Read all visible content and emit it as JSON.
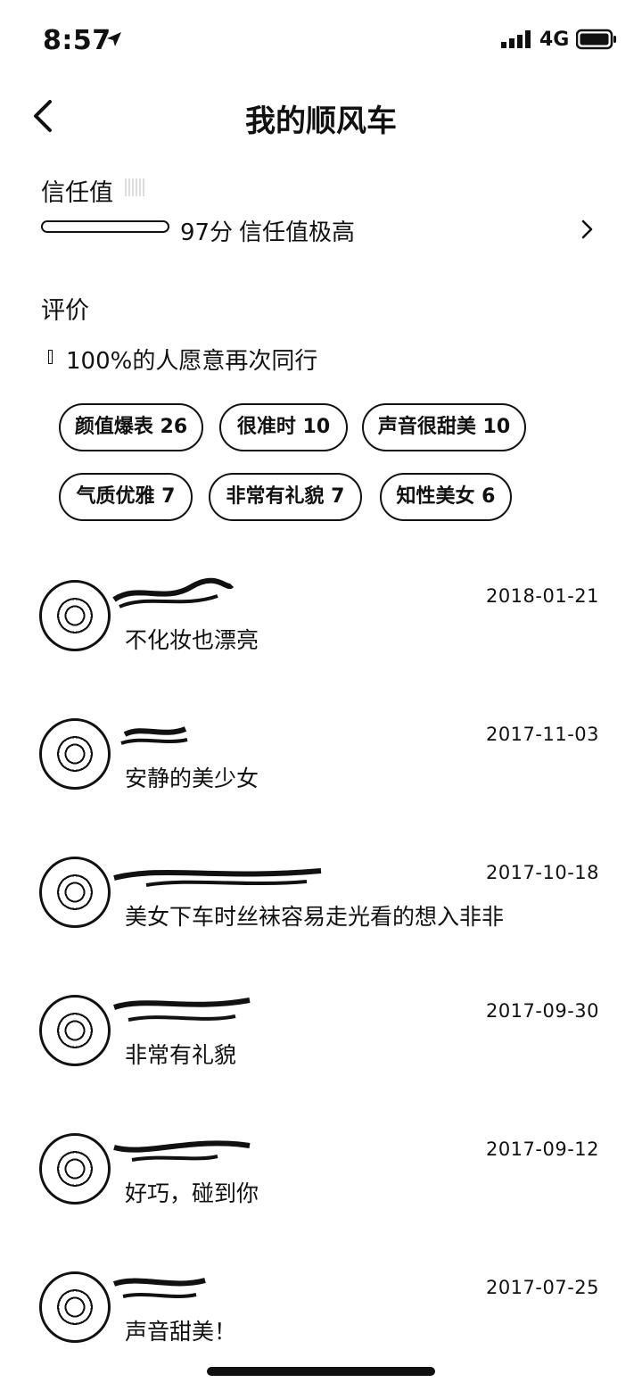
{
  "status_bar": {
    "time": "8:57",
    "network": "4G",
    "location_icon": "location-arrow-icon",
    "signal_icon": "cellular-signal-icon",
    "battery_icon": "battery-icon"
  },
  "nav": {
    "title": "我的顺风车",
    "back_icon": "chevron-left-icon"
  },
  "trust": {
    "label": "信任值",
    "score": "97分",
    "level_text": "信任值极高",
    "score_fraction": 0.97
  },
  "reviews": {
    "label": "评价",
    "willing_text": "100%的人愿意再次同行",
    "tags": [
      [
        "颜值爆表 26",
        "很准时 10",
        "声音很甜美 10"
      ],
      [
        "气质优雅 7",
        "非常有礼貌 7",
        "知性美女 6"
      ]
    ]
  },
  "comments": [
    {
      "date": "2018-01-21",
      "text": "不化妆也漂亮"
    },
    {
      "date": "2017-11-03",
      "text": "安静的美少女"
    },
    {
      "date": "2017-10-18",
      "text": "美女下车时丝袜容易走光看的想入非非"
    },
    {
      "date": "2017-09-30",
      "text": "非常有礼貌"
    },
    {
      "date": "2017-09-12",
      "text": "好巧，碰到你"
    },
    {
      "date": "2017-07-25",
      "text": "声音甜美！"
    }
  ]
}
